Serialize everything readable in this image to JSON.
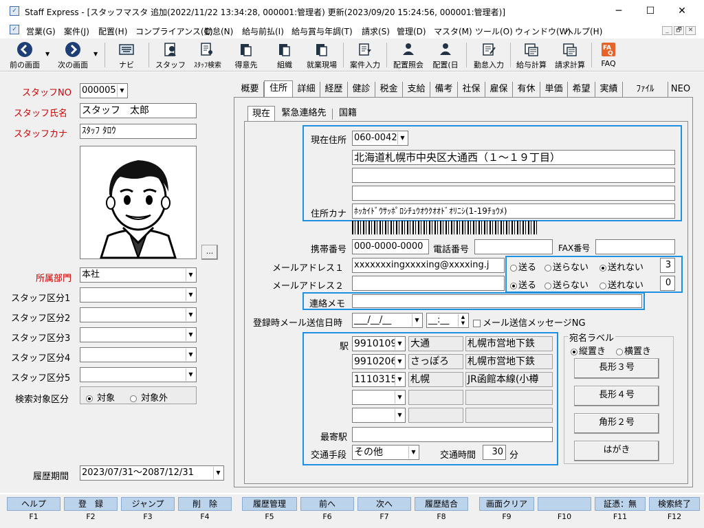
{
  "window": {
    "title": "Staff Express - [スタッフマスタ 追加(2022/11/22 13:34:28, 000001:管理者) 更新(2023/09/20 15:24:56, 000001:管理者)]",
    "minimize": "─",
    "maximize": "☐",
    "close": "✕"
  },
  "menu": [
    "営業(G)",
    "案件(J)",
    "配置(H)",
    "コンプライアンス(C)",
    "勤怠(N)",
    "給与前払(I)",
    "給与賞与年調(T)",
    "請求(S)",
    "管理(D)",
    "マスタ(M)",
    "ツール(O)",
    "ウィンドウ(W)",
    "ヘルプ(H)"
  ],
  "mdi": {
    "minimize": "_",
    "restore": "🗗",
    "close": "✕"
  },
  "toolbar": [
    {
      "label": "前の画面",
      "icon": "back-arrow-icon"
    },
    {
      "label": "次の画面",
      "icon": "forward-arrow-icon"
    },
    {
      "label": "ナビ",
      "icon": "keyboard-icon"
    },
    {
      "label": "スタッフ",
      "icon": "staff-icon"
    },
    {
      "label": "ｽﾀｯﾌ検索",
      "icon": "staff-search-icon"
    },
    {
      "label": "得意先",
      "icon": "customer-icon"
    },
    {
      "label": "組織",
      "icon": "organization-icon"
    },
    {
      "label": "就業現場",
      "icon": "workplace-icon"
    },
    {
      "label": "案件入力",
      "icon": "job-entry-icon"
    },
    {
      "label": "配置照会",
      "icon": "placement-query-icon"
    },
    {
      "label": "配置(日",
      "icon": "placement-daily-icon"
    },
    {
      "label": "勤怠入力",
      "icon": "attendance-entry-icon"
    },
    {
      "label": "給与計算",
      "icon": "payroll-icon"
    },
    {
      "label": "請求計算",
      "icon": "billing-icon"
    },
    {
      "label": "FAQ",
      "icon": "faq-icon"
    }
  ],
  "left": {
    "staff_no_label": "スタッフNO",
    "staff_no_value": "000005",
    "staff_name_label": "スタッフ氏名",
    "staff_name_value": "スタッフ　太郎",
    "staff_kana_label": "スタッフカナ",
    "staff_kana_value": "ｽﾀｯﾌ ﾀﾛｳ",
    "photo_button": "...",
    "dept_label": "所属部門",
    "dept_value": "本社",
    "class1_label": "スタッフ区分1",
    "class2_label": "スタッフ区分2",
    "class3_label": "スタッフ区分3",
    "class4_label": "スタッフ区分4",
    "class5_label": "スタッフ区分5",
    "search_label": "検索対象区分",
    "search_opt1": "対象",
    "search_opt2": "対象外",
    "period_label": "履歴期間",
    "period_value": "2023/07/31～2087/12/31"
  },
  "tabs": [
    "概要",
    "住所",
    "詳細",
    "経歴",
    "健診",
    "税金",
    "支給",
    "備考",
    "社保",
    "雇保",
    "有休",
    "単価",
    "希望",
    "実績",
    "ﾌｧｲﾙ",
    "NEO"
  ],
  "subtabs": [
    "現在",
    "緊急連絡先",
    "国籍"
  ],
  "address": {
    "current_label": "現在住所",
    "postal": "060-0042",
    "line1": "北海道札幌市中央区大通西（１～１９丁目）",
    "line2": "",
    "line3": "",
    "kana_label": "住所カナ",
    "kana_value": "ﾎｯｶｲﾄﾞｳｻｯﾎﾟﾛｼﾁｭｳｵｳｸｵｵﾄﾞｵﾘﾆｼ(1-19ﾁｮｳﾒ)"
  },
  "contact": {
    "mobile_label": "携帯番号",
    "mobile_value": "000-0000-0000",
    "phone_label": "電話番号",
    "fax_label": "FAX番号",
    "mail1_label": "メールアドレス１",
    "mail1_value": "xxxxxxxingxxxxing@xxxxing.j",
    "mail2_label": "メールアドレス２",
    "send": "送る",
    "nosend": "送らない",
    "cannot": "送れない",
    "mail1_count": "3",
    "mail2_count": "0",
    "memo_label": "連絡メモ",
    "reg_mail_label": "登録時メール送信日時",
    "reg_date": "___/__/__",
    "reg_time": "__:__",
    "mail_ng_label": "メール送信メッセージNG"
  },
  "station": {
    "station_label": "駅",
    "rows": [
      {
        "code": "9910109",
        "name": "大通",
        "line": "札幌市営地下鉄"
      },
      {
        "code": "9910206",
        "name": "さっぽろ",
        "line": "札幌市営地下鉄"
      },
      {
        "code": "1110315",
        "name": "札幌",
        "line": "JR函館本線(小樽"
      },
      {
        "code": "",
        "name": "",
        "line": ""
      },
      {
        "code": "",
        "name": "",
        "line": ""
      }
    ],
    "nearest_label": "最寄駅",
    "transport_label": "交通手段",
    "transport_value": "その他",
    "time_label": "交通時間",
    "time_value": "30",
    "time_unit": "分"
  },
  "label_group": {
    "title": "宛名ラベル",
    "vertical": "縦置き",
    "horizontal": "横置き",
    "buttons": [
      "長形３号",
      "長形４号",
      "角形２号",
      "はがき"
    ]
  },
  "fkeys": [
    {
      "label": "ヘルプ",
      "key": "F1"
    },
    {
      "label": "登　録",
      "key": "F2"
    },
    {
      "label": "ジャンプ",
      "key": "F3"
    },
    {
      "label": "削　除",
      "key": "F4"
    },
    {
      "label": "履歴管理",
      "key": "F5"
    },
    {
      "label": "前へ",
      "key": "F6"
    },
    {
      "label": "次へ",
      "key": "F7"
    },
    {
      "label": "履歴結合",
      "key": "F8"
    },
    {
      "label": "画面クリア",
      "key": "F9"
    },
    {
      "label": "",
      "key": "F10"
    },
    {
      "label": "証憑：無",
      "key": "F11"
    },
    {
      "label": "検索終了",
      "key": "F12"
    }
  ]
}
